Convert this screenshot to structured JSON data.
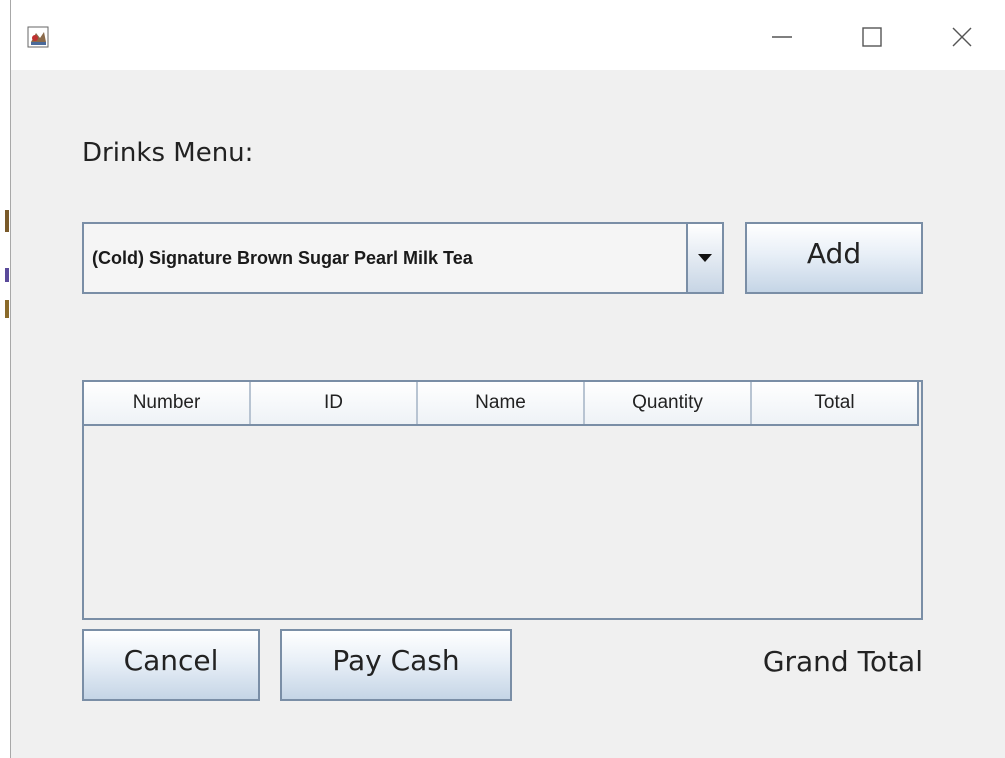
{
  "window": {
    "icons": {
      "app": "java-app-icon",
      "minimize": "minimize-icon",
      "maximize": "maximize-icon",
      "close": "close-icon"
    }
  },
  "menu": {
    "label": "Drinks Menu:",
    "selected_drink": "(Cold) Signature Brown Sugar Pearl Milk Tea",
    "add_label": "Add"
  },
  "order_table": {
    "columns": [
      "Number",
      "ID",
      "Name",
      "Quantity",
      "Total"
    ],
    "rows": []
  },
  "footer": {
    "cancel_label": "Cancel",
    "pay_cash_label": "Pay Cash",
    "grand_total_label": "Grand Total"
  },
  "colors": {
    "window_bg": "#f0f0f0",
    "border": "#7a8ea6",
    "button_gradient_end": "#c5d5e6"
  }
}
